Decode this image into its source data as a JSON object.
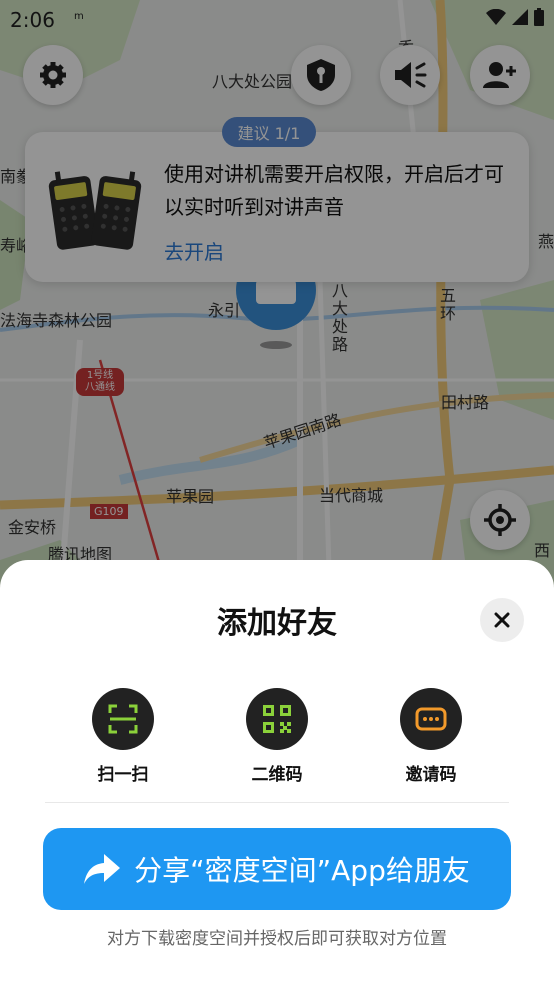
{
  "status_bar": {
    "time": "2:06",
    "mini_icon": "m"
  },
  "map": {
    "labels": {
      "park": "八大处公园",
      "south": "南豢",
      "shou": "寿峪",
      "fahai": "法海寺森林公园",
      "yong": "永引",
      "line1": "1号线 八通线",
      "pingguo_rd": "苹果园南路",
      "pingguoyuan": "苹果园",
      "dangdai": "当代商城",
      "jinanqiao": "金安桥",
      "tencent": "腾讯地图",
      "g109": "G109",
      "badachu_rd": "八大处路",
      "wuhuan": "五环",
      "tiancun": "田村路",
      "yan": "燕",
      "xi": "西",
      "xiang": "香"
    }
  },
  "suggestion": {
    "pill": "建议 1/1",
    "message": "使用对讲机需要开启权限，开启后才可以实时听到对讲声音",
    "action": "去开启"
  },
  "sheet": {
    "title": "添加好友",
    "actions": [
      {
        "label": "扫一扫",
        "icon": "scan-icon"
      },
      {
        "label": "二维码",
        "icon": "qrcode-icon"
      },
      {
        "label": "邀请码",
        "icon": "invite-code-icon"
      }
    ],
    "share_button": "分享“密度空间”App给朋友",
    "hint": "对方下载密度空间并授权后即可获取对方位置"
  },
  "colors": {
    "accent": "#1e97f2",
    "link": "#2d7ad6",
    "icon_green": "#8bd13a",
    "icon_orange": "#f39a2b"
  }
}
